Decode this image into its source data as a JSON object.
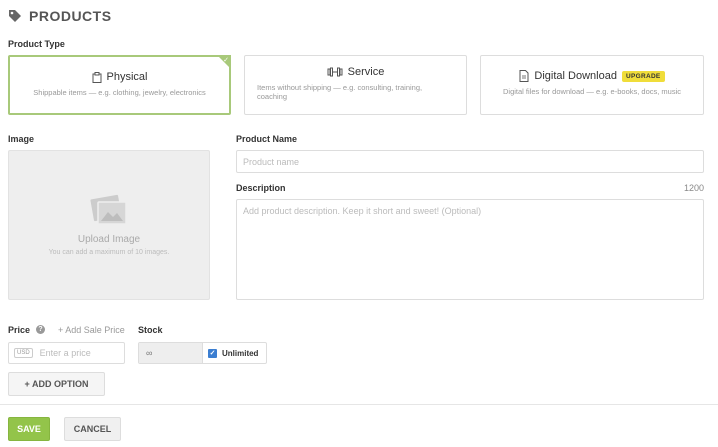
{
  "header": {
    "title": "PRODUCTS",
    "icon": "tag-icon"
  },
  "product_type": {
    "label": "Product Type",
    "options": [
      {
        "title": "Physical",
        "desc": "Shippable items — e.g. clothing, jewelry, electronics",
        "selected": true
      },
      {
        "title": "Service",
        "desc": "Items without shipping — e.g. consulting, training, coaching",
        "selected": false
      },
      {
        "title": "Digital Download",
        "desc": "Digital files for download — e.g. e-books, docs, music",
        "badge": "UPGRADE",
        "selected": false
      }
    ]
  },
  "image": {
    "label": "Image",
    "upload_title": "Upload Image",
    "upload_sub": "You can add a maximum of 10 images."
  },
  "product_name": {
    "label": "Product Name",
    "placeholder": "Product name"
  },
  "description": {
    "label": "Description",
    "counter": "1200",
    "placeholder": "Add product description. Keep it short and sweet! (Optional)"
  },
  "price": {
    "label": "Price",
    "help": "?",
    "add_sale": "+ Add Sale Price",
    "currency": "USD",
    "placeholder": "Enter a price"
  },
  "stock": {
    "label": "Stock",
    "value": "∞",
    "unlimited_label": "Unlimited",
    "unlimited_checked": true
  },
  "buttons": {
    "add_option": "+ ADD OPTION",
    "save": "SAVE",
    "cancel": "CANCEL"
  },
  "colors": {
    "accent": "#93c44a",
    "selected_border": "#a8c97a",
    "badge": "#f0dd3a",
    "checkbox": "#3b7ed1"
  }
}
